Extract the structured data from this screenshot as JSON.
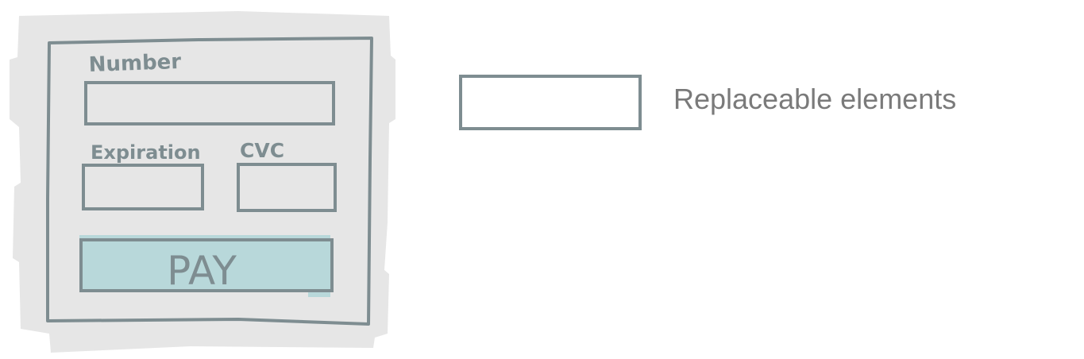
{
  "form": {
    "number_label": "Number",
    "expiration_label": "Expiration",
    "cvc_label": "CVC",
    "pay_label": "PAY"
  },
  "legend": {
    "label": "Replaceable elements"
  },
  "colors": {
    "background_shape": "#e6e6e6",
    "outline": "#7e8d91",
    "button_fill": "#b8d8da",
    "legend_text": "#7a7a7a"
  }
}
